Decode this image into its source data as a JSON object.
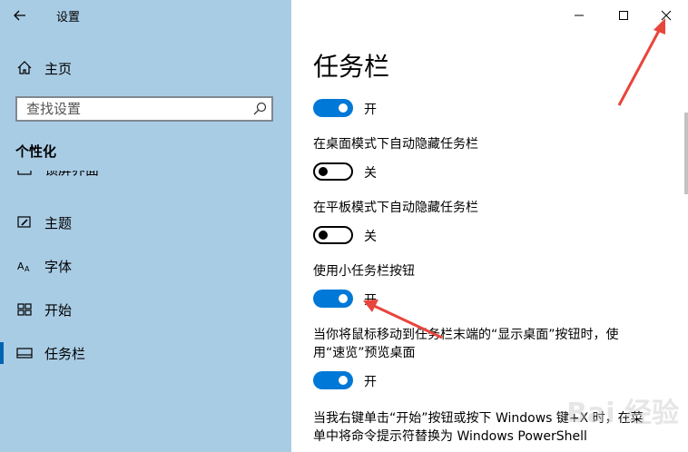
{
  "window": {
    "title": "设置"
  },
  "sidebar": {
    "home_label": "主页",
    "search_placeholder": "查找设置",
    "section_title": "个性化",
    "partial_item_label": "锁屏界面",
    "items": [
      {
        "label": "主题",
        "icon": "brush-icon"
      },
      {
        "label": "字体",
        "icon": "font-icon"
      },
      {
        "label": "开始",
        "icon": "start-icon"
      },
      {
        "label": "任务栏",
        "icon": "taskbar-icon",
        "active": true
      }
    ]
  },
  "main": {
    "page_title": "任务栏",
    "settings": [
      {
        "label": "",
        "state": "开",
        "on": true
      },
      {
        "label": "在桌面模式下自动隐藏任务栏",
        "state": "关",
        "on": false
      },
      {
        "label": "在平板模式下自动隐藏任务栏",
        "state": "关",
        "on": false
      },
      {
        "label": "使用小任务栏按钮",
        "state": "开",
        "on": true
      },
      {
        "label_line1": "当你将鼠标移动到任务栏末端的“显示桌面”按钮时，使",
        "label_line2": "用“速览”预览桌面",
        "state": "开",
        "on": true
      }
    ],
    "last_setting": {
      "line1": "当我右键单击“开始”按钮或按下 Windows 键+X 时，在菜",
      "line2": "单中将命令提示符替换为 Windows PowerShell"
    }
  },
  "colors": {
    "accent": "#0078d7",
    "sidebar_bg": "#a9cce5",
    "annotation": "#e8453c"
  },
  "watermark": "Bai 经验"
}
